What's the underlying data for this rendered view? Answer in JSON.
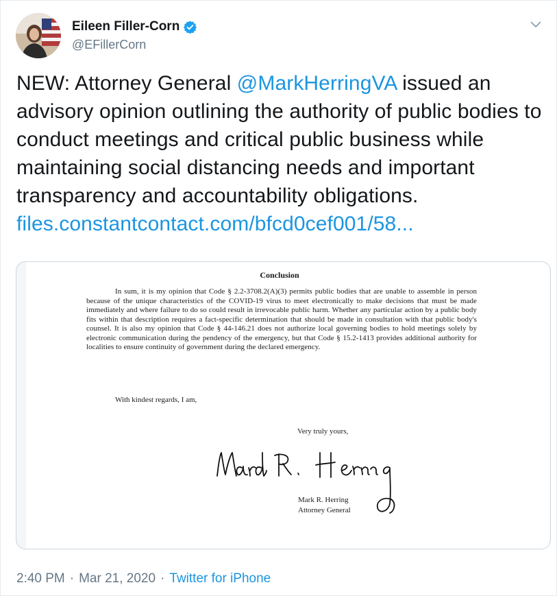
{
  "author": {
    "display_name": "Eileen Filler-Corn",
    "handle": "@EFillerCorn",
    "verified": true,
    "avatar_icon": "user-avatar-photo"
  },
  "tweet": {
    "text_prefix": "NEW: Attorney General ",
    "mention": "@MarkHerringVA",
    "text_suffix": " issued an advisory opinion outlining the authority of public bodies to conduct meetings and critical public business while maintaining social distancing needs and important transparency and accountability obligations. ",
    "link": "files.constantcontact.com/bfcd0cef001/58..."
  },
  "document": {
    "heading": "Conclusion",
    "body": "In sum, it is my opinion that Code § 2.2-3708.2(A)(3) permits public bodies that are unable to assemble in person because of the unique characteristics of the COVID-19 virus to meet electronically to make decisions that must be made immediately and where failure to do so could result in irrevocable public harm. Whether any particular action by a public body fits within that description requires a fact-specific determination that should be made in consultation with that public body's counsel. It is also my opinion that Code § 44-146.21 does not authorize local governing bodies to hold meetings solely by electronic communication during the pendency of the emergency, but that Code § 15.2-1413 provides additional authority for localities to ensure continuity of government during the declared emergency.",
    "closing": "With kindest regards, I am,",
    "valediction": "Very truly yours,",
    "signature_text": "Mark R. Herring",
    "signer_name": "Mark R. Herring",
    "signer_title": "Attorney General"
  },
  "footer": {
    "time": "2:40 PM",
    "separator": "·",
    "date": "Mar 21, 2020",
    "source": "Twitter for iPhone"
  },
  "colors": {
    "link": "#1b95e0",
    "secondary": "#657786",
    "text": "#14171a"
  }
}
